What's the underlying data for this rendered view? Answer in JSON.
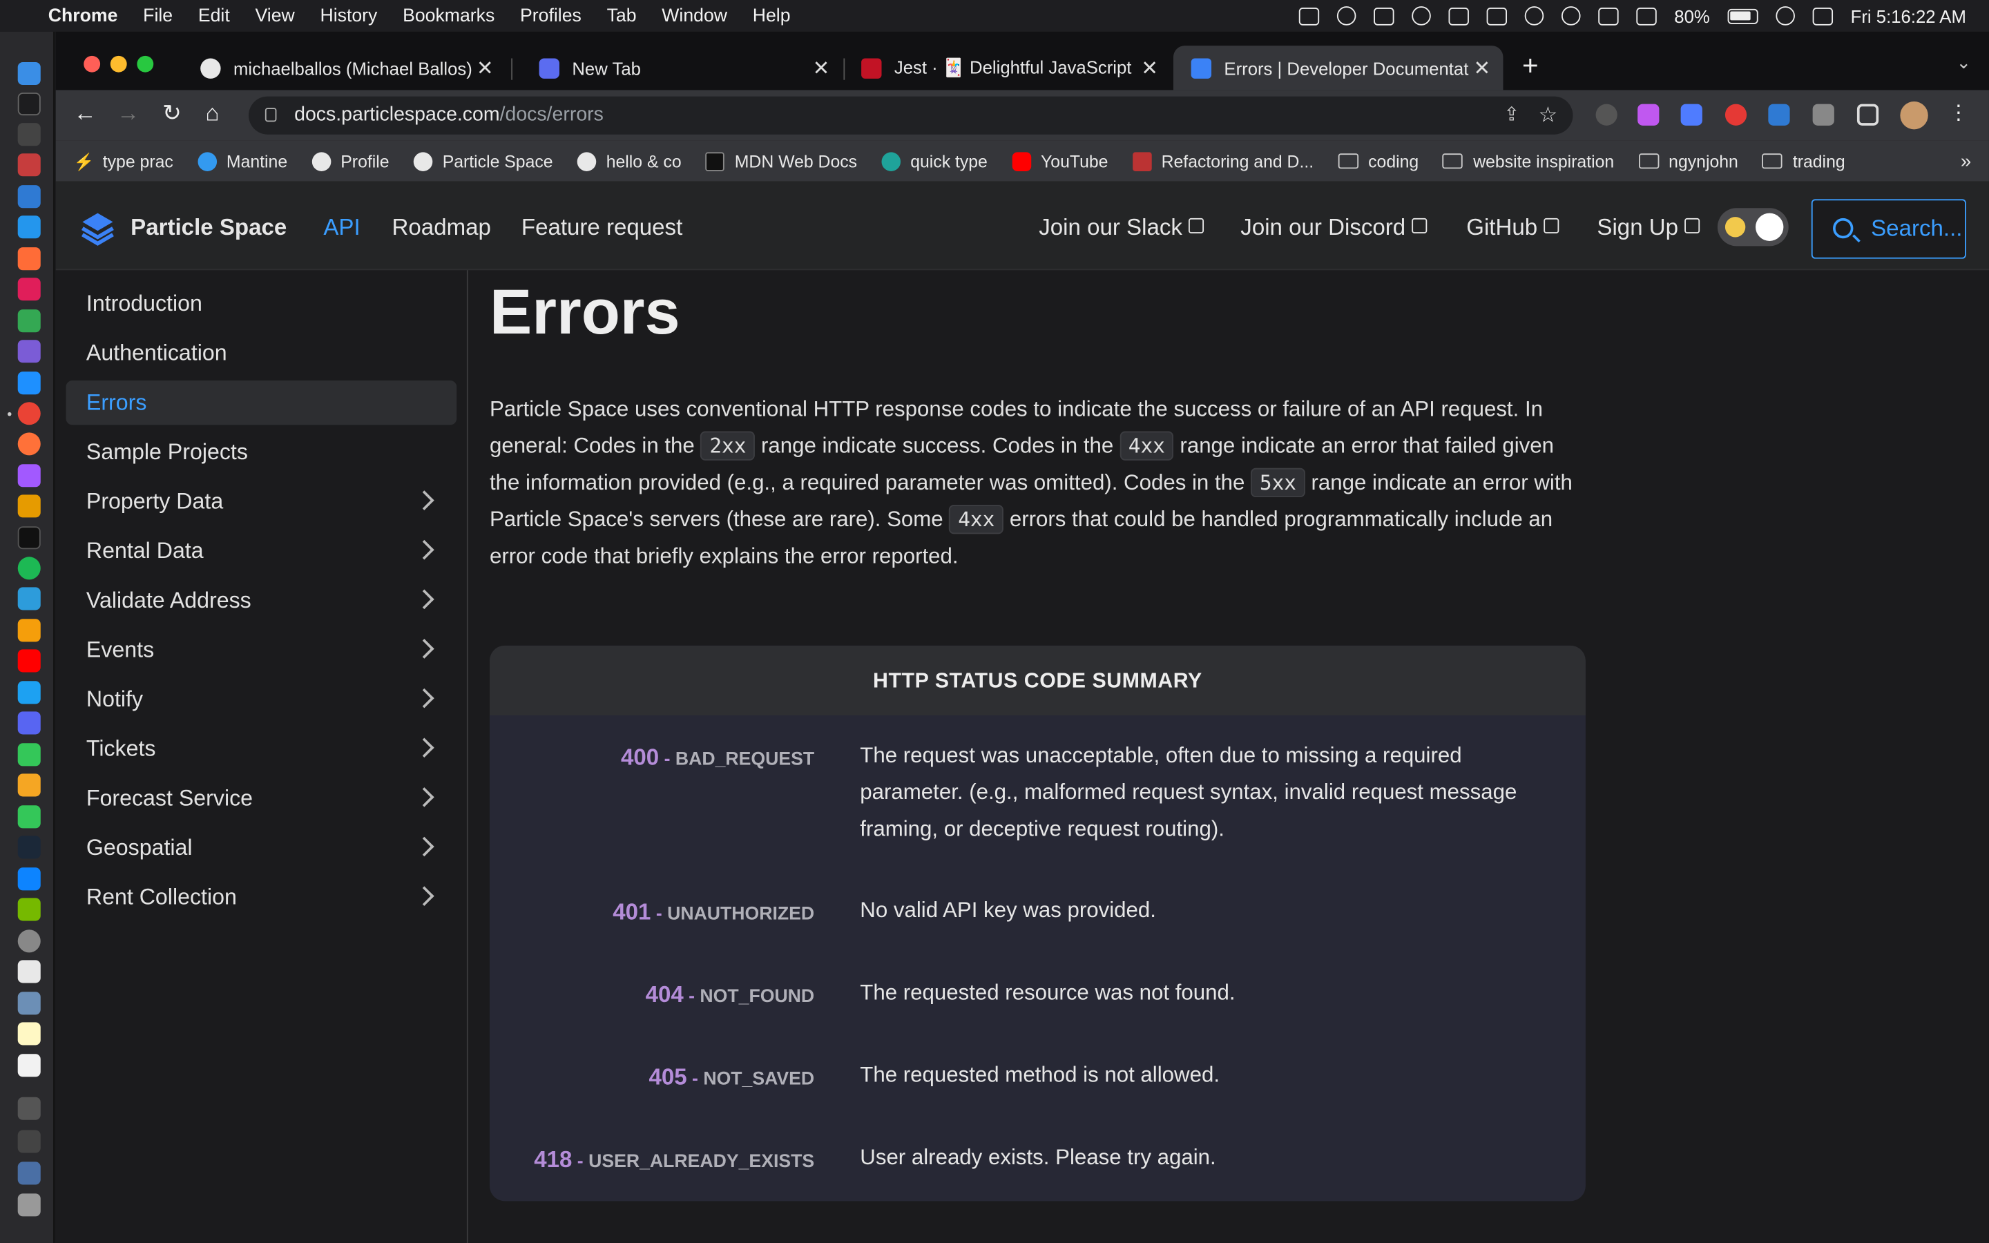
{
  "menubar": {
    "app": "Chrome",
    "items": [
      "File",
      "Edit",
      "View",
      "History",
      "Bookmarks",
      "Profiles",
      "Tab",
      "Window",
      "Help"
    ],
    "battery": "80%",
    "clock": "Fri  5:16:22 AM"
  },
  "tabs": [
    {
      "title": "michaelballos (Michael Ballos)"
    },
    {
      "title": "New Tab"
    },
    {
      "title": "Jest · 🃏 Delightful JavaScript"
    },
    {
      "title": "Errors | Developer Documentat"
    }
  ],
  "url": {
    "host": "docs.particlespace.com",
    "path": "/docs/errors"
  },
  "bookmarks": [
    "type prac",
    "Mantine",
    "Profile",
    "Particle Space",
    "hello & co",
    "MDN Web Docs",
    "quick type",
    "YouTube",
    "Refactoring and D...",
    "coding",
    "website inspiration",
    "ngynjohn",
    "trading"
  ],
  "site": {
    "brand": "Particle Space",
    "nav": [
      "API",
      "Roadmap",
      "Feature request"
    ],
    "external": [
      "Join our Slack",
      "Join our Discord",
      "GitHub",
      "Sign Up"
    ],
    "search_placeholder": "Search..."
  },
  "sidebar": {
    "items": [
      {
        "label": "Introduction"
      },
      {
        "label": "Authentication"
      },
      {
        "label": "Errors"
      },
      {
        "label": "Sample Projects"
      },
      {
        "label": "Property Data"
      },
      {
        "label": "Rental Data"
      },
      {
        "label": "Validate Address"
      },
      {
        "label": "Events"
      },
      {
        "label": "Notify"
      },
      {
        "label": "Tickets"
      },
      {
        "label": "Forecast Service"
      },
      {
        "label": "Geospatial"
      },
      {
        "label": "Rent Collection"
      }
    ]
  },
  "page": {
    "title": "Errors",
    "intro": {
      "t1": "Particle Space uses conventional HTTP response codes to indicate the success or failure of an API request. In general: Codes in the ",
      "c1": "2xx",
      "t2": " range indicate success. Codes in the ",
      "c2": "4xx",
      "t3": " range indicate an error that failed given the information provided (e.g., a required parameter was omitted). Codes in the ",
      "c3": "5xx",
      "t4": " range indicate an error with Particle Space's servers (these are rare). Some ",
      "c4": "4xx",
      "t5": " errors that could be handled programmatically include an error code that briefly explains the error reported."
    },
    "table": {
      "title": "HTTP STATUS CODE SUMMARY",
      "rows": [
        {
          "code": "400",
          "name": "BAD_REQUEST",
          "desc": "The request was unacceptable, often due to missing a required parameter. (e.g., malformed request syntax, invalid request message framing, or deceptive request routing)."
        },
        {
          "code": "401",
          "name": "UNAUTHORIZED",
          "desc": "No valid API key was provided."
        },
        {
          "code": "404",
          "name": "NOT_FOUND",
          "desc": "The requested resource was not found."
        },
        {
          "code": "405",
          "name": "NOT_SAVED",
          "desc": "The requested method is not allowed."
        },
        {
          "code": "418",
          "name": "USER_ALREADY_EXISTS",
          "desc": "User already exists. Please try again."
        }
      ]
    }
  },
  "colors": {
    "accent": "#3b9eff",
    "code_number": "#b48cd8",
    "background": "#1b1b1d"
  }
}
